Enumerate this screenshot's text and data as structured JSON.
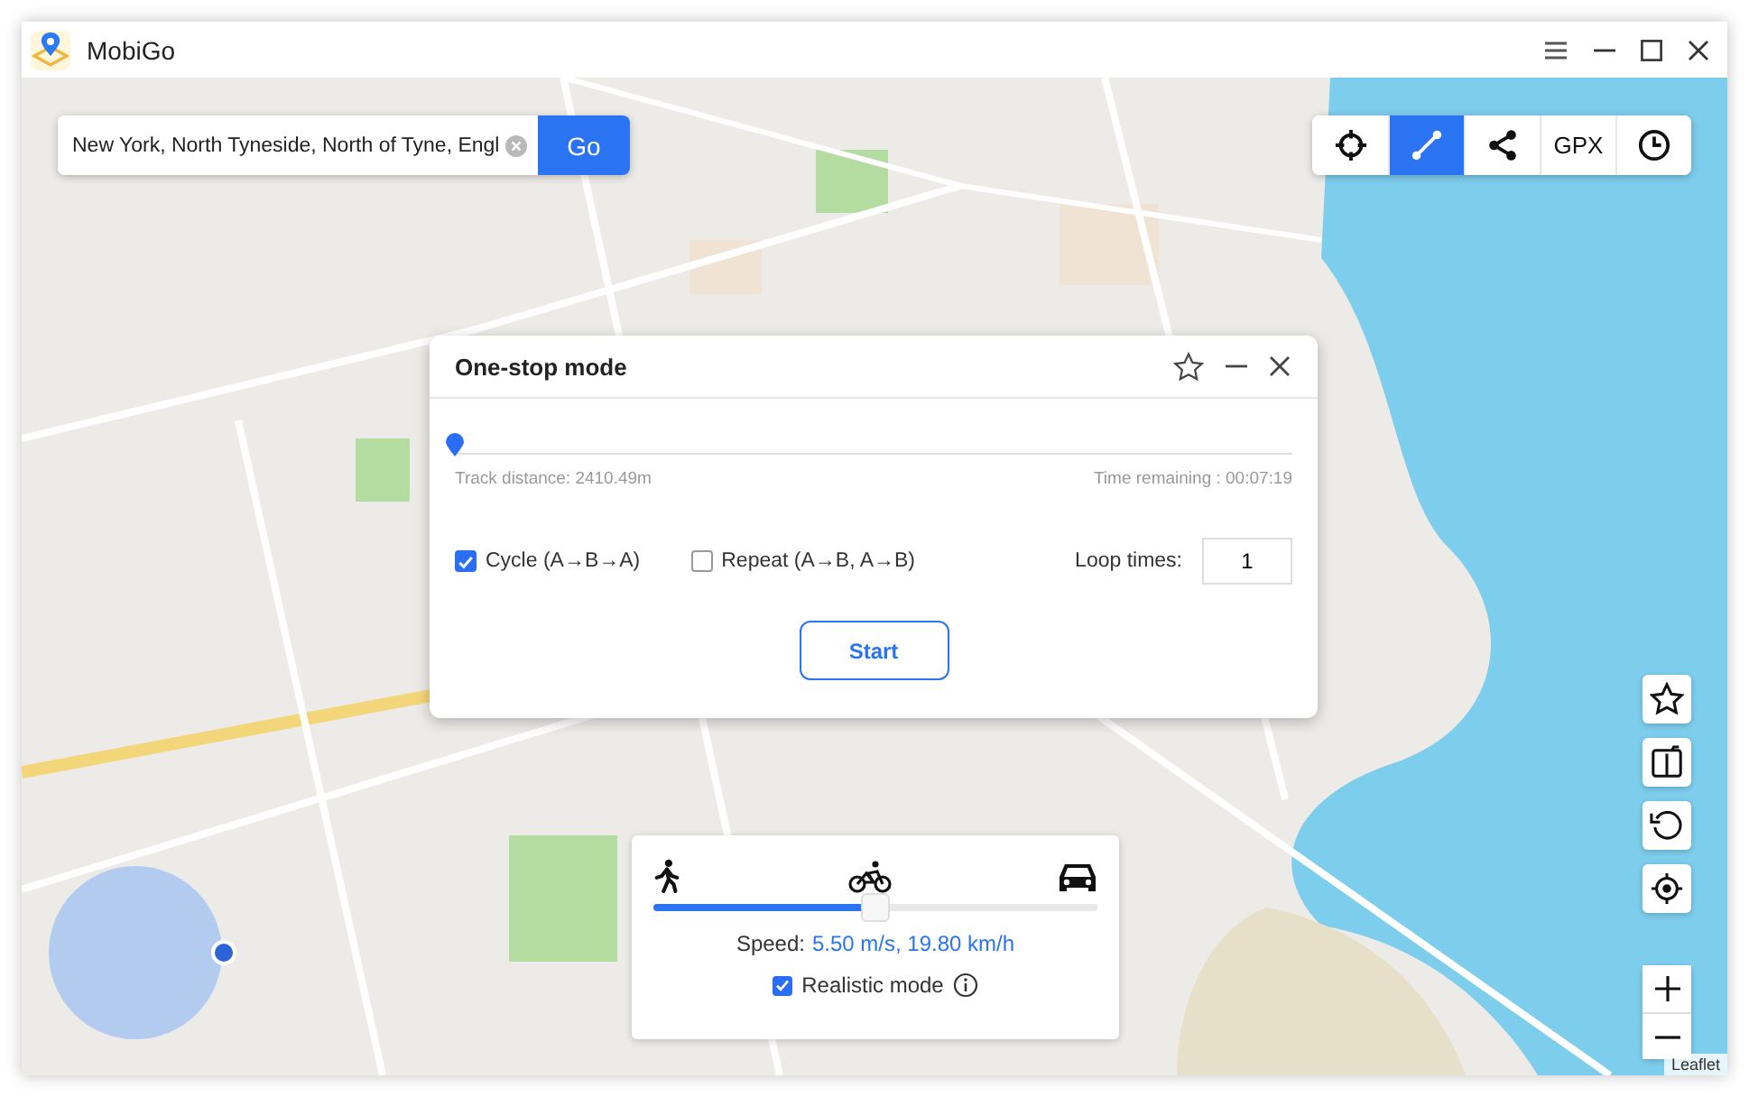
{
  "window": {
    "title": "MobiGo"
  },
  "search": {
    "value": "New York, North Tyneside, North of Tyne, Engl",
    "button": "Go"
  },
  "toolbar": [
    {
      "kind": "teleport",
      "selected": false
    },
    {
      "kind": "one-stop",
      "selected": true
    },
    {
      "kind": "multi-stop",
      "selected": false
    },
    {
      "kind": "gpx",
      "label": "GPX",
      "selected": false
    },
    {
      "kind": "history",
      "selected": false
    }
  ],
  "dialog": {
    "title": "One-stop mode",
    "progress": {
      "level": 0
    },
    "track_distance": "Track distance: 2410.49m",
    "time_remaining": "Time remaining : 00:07:19",
    "options": [
      {
        "label": "Cycle (A→B→A)",
        "checked": true
      },
      {
        "label": "Repeat (A→B, A→B)",
        "checked": false
      }
    ],
    "loop_label": "Loop times:",
    "loop_value": "1",
    "start": "Start"
  },
  "speed_panel": {
    "level": 0.5,
    "speed_label": "Speed:",
    "speed_value": "5.50 m/s, 19.80 km/h",
    "realistic": {
      "label": "Realistic mode",
      "checked": true
    }
  },
  "side_tools": [
    {
      "kind": "favorite"
    },
    {
      "kind": "split"
    },
    {
      "kind": "reset"
    },
    {
      "kind": "locate"
    }
  ],
  "attribution": "Leaflet"
}
